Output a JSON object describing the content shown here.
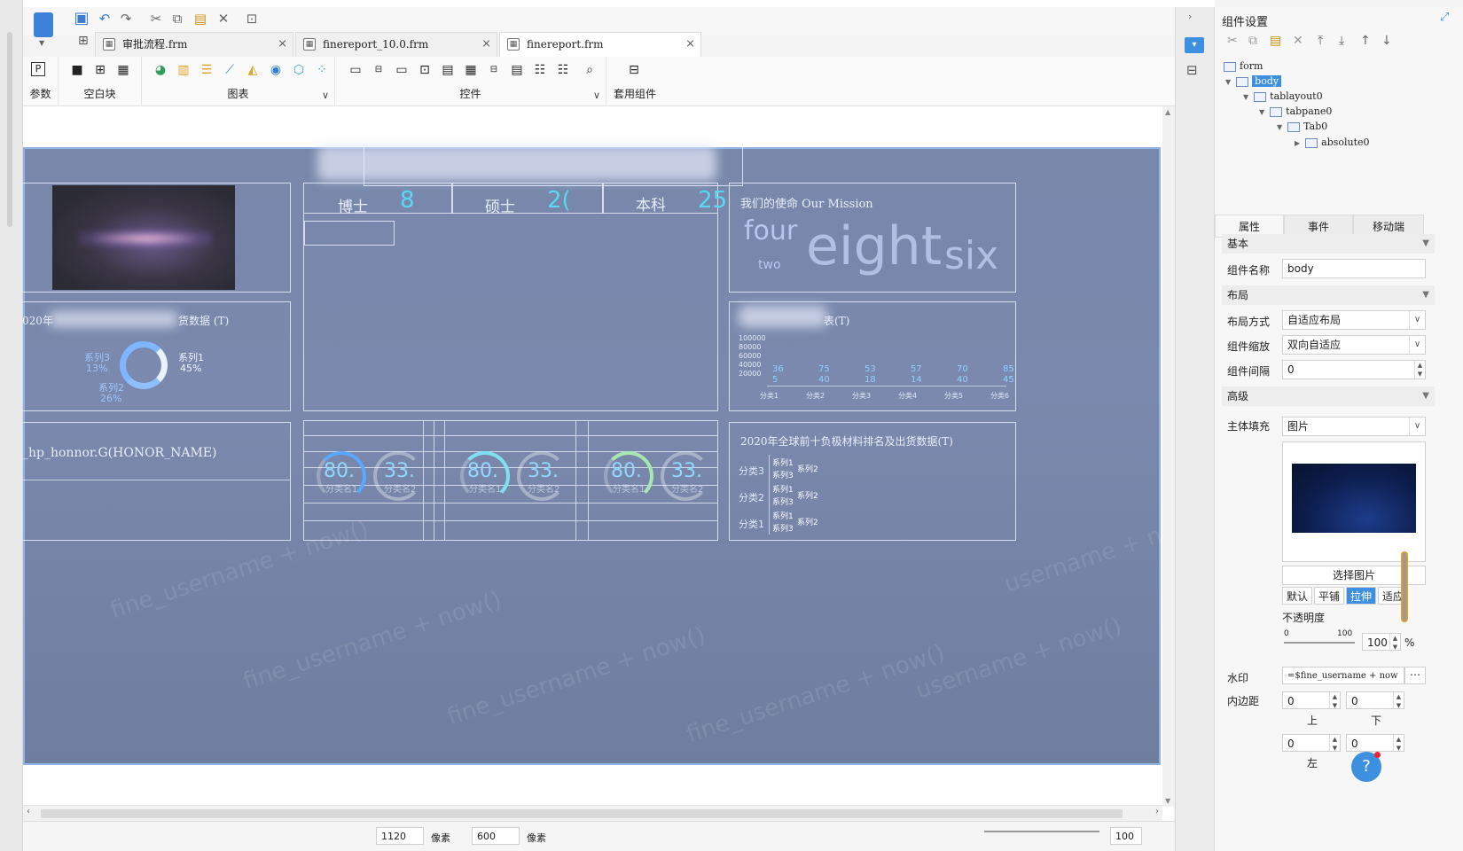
{
  "tabs": [
    {
      "label": "审批流程.frm"
    },
    {
      "label": "finereport_10.0.frm"
    },
    {
      "label": "finereport.frm"
    }
  ],
  "ribbon": {
    "params": "参数",
    "blank": "空白块",
    "chart": "图表",
    "controls": "控件",
    "templates": "套用组件"
  },
  "canvas": {
    "edu": [
      {
        "label": "博士",
        "value": "8"
      },
      {
        "label": "硕士",
        "value": "2("
      },
      {
        "label": "本科",
        "value": "25"
      }
    ],
    "mission_title": "我们的使命 Our Mission",
    "words": {
      "four": "four",
      "two": "two",
      "eight": "eight",
      "six": "six"
    },
    "donut_title_l": "020年",
    "donut_title_r": "货数据 (T)",
    "donut": [
      {
        "name": "系列3",
        "pct": "13%"
      },
      {
        "name": "系列1",
        "pct": "45%"
      },
      {
        "name": "系列2",
        "pct": "26%"
      }
    ],
    "honor": "_hp_honnor.G(HONOR_NAME)",
    "bar_title_suffix": "表(T)",
    "yticks": [
      "100000",
      "80000",
      "60000",
      "40000",
      "20000"
    ],
    "bar_vals_top": [
      "36",
      "75",
      "53",
      "57",
      "70",
      "85"
    ],
    "bar_vals_bot": [
      "5",
      "40",
      "18",
      "14",
      "40",
      "45"
    ],
    "bar_cats": [
      "分类1",
      "分类2",
      "分类3",
      "分类4",
      "分类5",
      "分类6"
    ],
    "gauge_big": "80.",
    "gauge_small": "33.",
    "gauge_lbl1": "分类名1",
    "gauge_lbl2": "分类名2",
    "rank_title": "2020年全球前十负极材料排名及出货数据(T)",
    "rank_rows": [
      {
        "cat": "分类3",
        "s1": "系列1",
        "s3": "系列3",
        "s2": "系列2"
      },
      {
        "cat": "分类2",
        "s1": "系列1",
        "s3": "系列3",
        "s2": "系列2"
      },
      {
        "cat": "分类1",
        "s1": "系列1",
        "s3": "系列3",
        "s2": "系列2"
      }
    ]
  },
  "status": {
    "width": "1120",
    "unit1": "像素",
    "height": "600",
    "unit2": "像素",
    "zoom": "100"
  },
  "right": {
    "title": "组件设置",
    "tree": {
      "form": "form",
      "body": "body",
      "tablayout": "tablayout0",
      "tabpane": "tabpane0",
      "tab": "Tab0",
      "absolute": "absolute0"
    },
    "ptabs": [
      "属性",
      "事件",
      "移动端"
    ],
    "sec_basic": "基本",
    "name_label": "组件名称",
    "name_value": "body",
    "sec_layout": "布局",
    "layout_mode_label": "布局方式",
    "layout_mode_value": "自适应布局",
    "scale_label": "组件缩放",
    "scale_value": "双向自适应",
    "gap_label": "组件间隔",
    "gap_value": "0",
    "sec_adv": "高级",
    "fill_label": "主体填充",
    "fill_value": "图片",
    "choose_image": "选择图片",
    "fit_opts": [
      "默认",
      "平铺",
      "拉伸",
      "适应"
    ],
    "opacity_label": "不透明度",
    "op_min": "0",
    "op_max": "100",
    "op_value": "100",
    "op_unit": "%",
    "wm_label": "水印",
    "wm_value": "=$fine_username + now",
    "padding_label": "内边距",
    "pad_top": "0",
    "pad_bottom": "0",
    "pad_left": "0",
    "pad_right": "0",
    "pad_top_lbl": "上",
    "pad_bottom_lbl": "下",
    "pad_left_lbl": "左",
    "help": "?"
  },
  "colors": {
    "accent": "#3d8fe0",
    "canvas": "#7788ab",
    "cyan": "#58d8f2"
  }
}
